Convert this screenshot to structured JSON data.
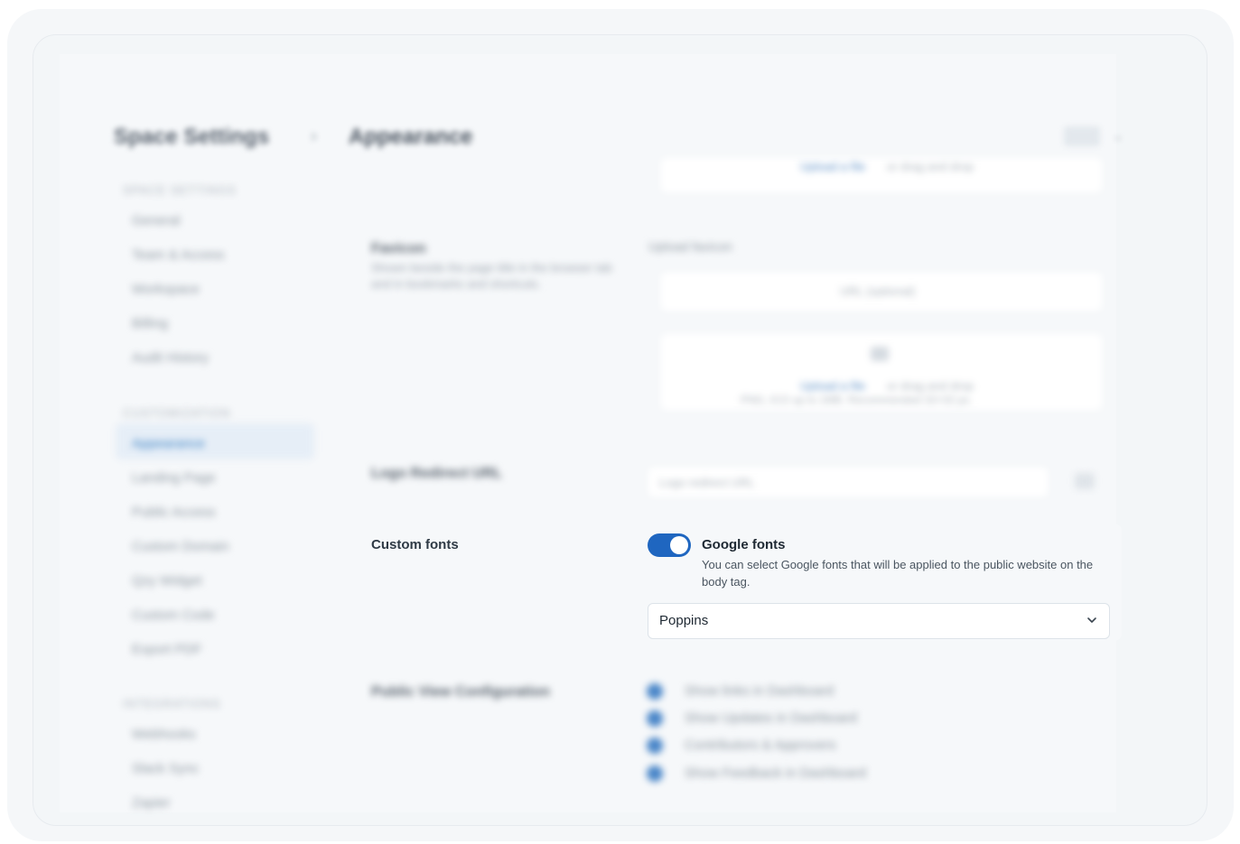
{
  "header": {
    "section_title": "Space Settings",
    "page_title": "Appearance"
  },
  "sidebar": {
    "sections": [
      {
        "title": "SPACE SETTINGS",
        "items": [
          "General",
          "Team & Access",
          "Workspace",
          "Billing",
          "Audit History"
        ]
      },
      {
        "title": "CUSTOMIZATION",
        "items": [
          "Appearance",
          "Landing Page",
          "Public Access",
          "Custom Domain",
          "Qzy Widget",
          "Custom Code",
          "Export PDF"
        ]
      },
      {
        "title": "INTEGRATIONS",
        "items": [
          "Webhooks",
          "Slack Sync",
          "Zapier"
        ]
      }
    ],
    "active_item": "Appearance"
  },
  "main": {
    "favicon": {
      "label": "Favicon",
      "desc": "Shown beside the page title in the browser tab and in bookmarks and shortcuts.",
      "upload_label": "Upload favicon",
      "url_placeholder": "URL (optional)",
      "link": "Upload a file",
      "link_suffix": "or drag and drop",
      "hint": "PNG, ICO up to 1MB. Recommended 32×32 px.",
      "top_link": "Upload a file",
      "top_suffix": "or drag and drop"
    },
    "logo_redirect": {
      "label": "Logo Redirect URL",
      "placeholder": "Logo redirect URL"
    },
    "custom_fonts": {
      "label": "Custom fonts",
      "toggle_on": true,
      "toggle_title": "Google fonts",
      "toggle_desc": "You can select Google fonts that will be applied to the public website on the body tag.",
      "selected_font": "Poppins"
    },
    "public_view": {
      "label": "Public View Configuration",
      "options": [
        "Show links in Dashboard",
        "Show Updates in Dashboard",
        "Contributors & Approvers",
        "Show Feedback in Dashboard"
      ]
    }
  },
  "colors": {
    "accent": "#1f66c0",
    "toggle_knob": "#ffffff"
  }
}
